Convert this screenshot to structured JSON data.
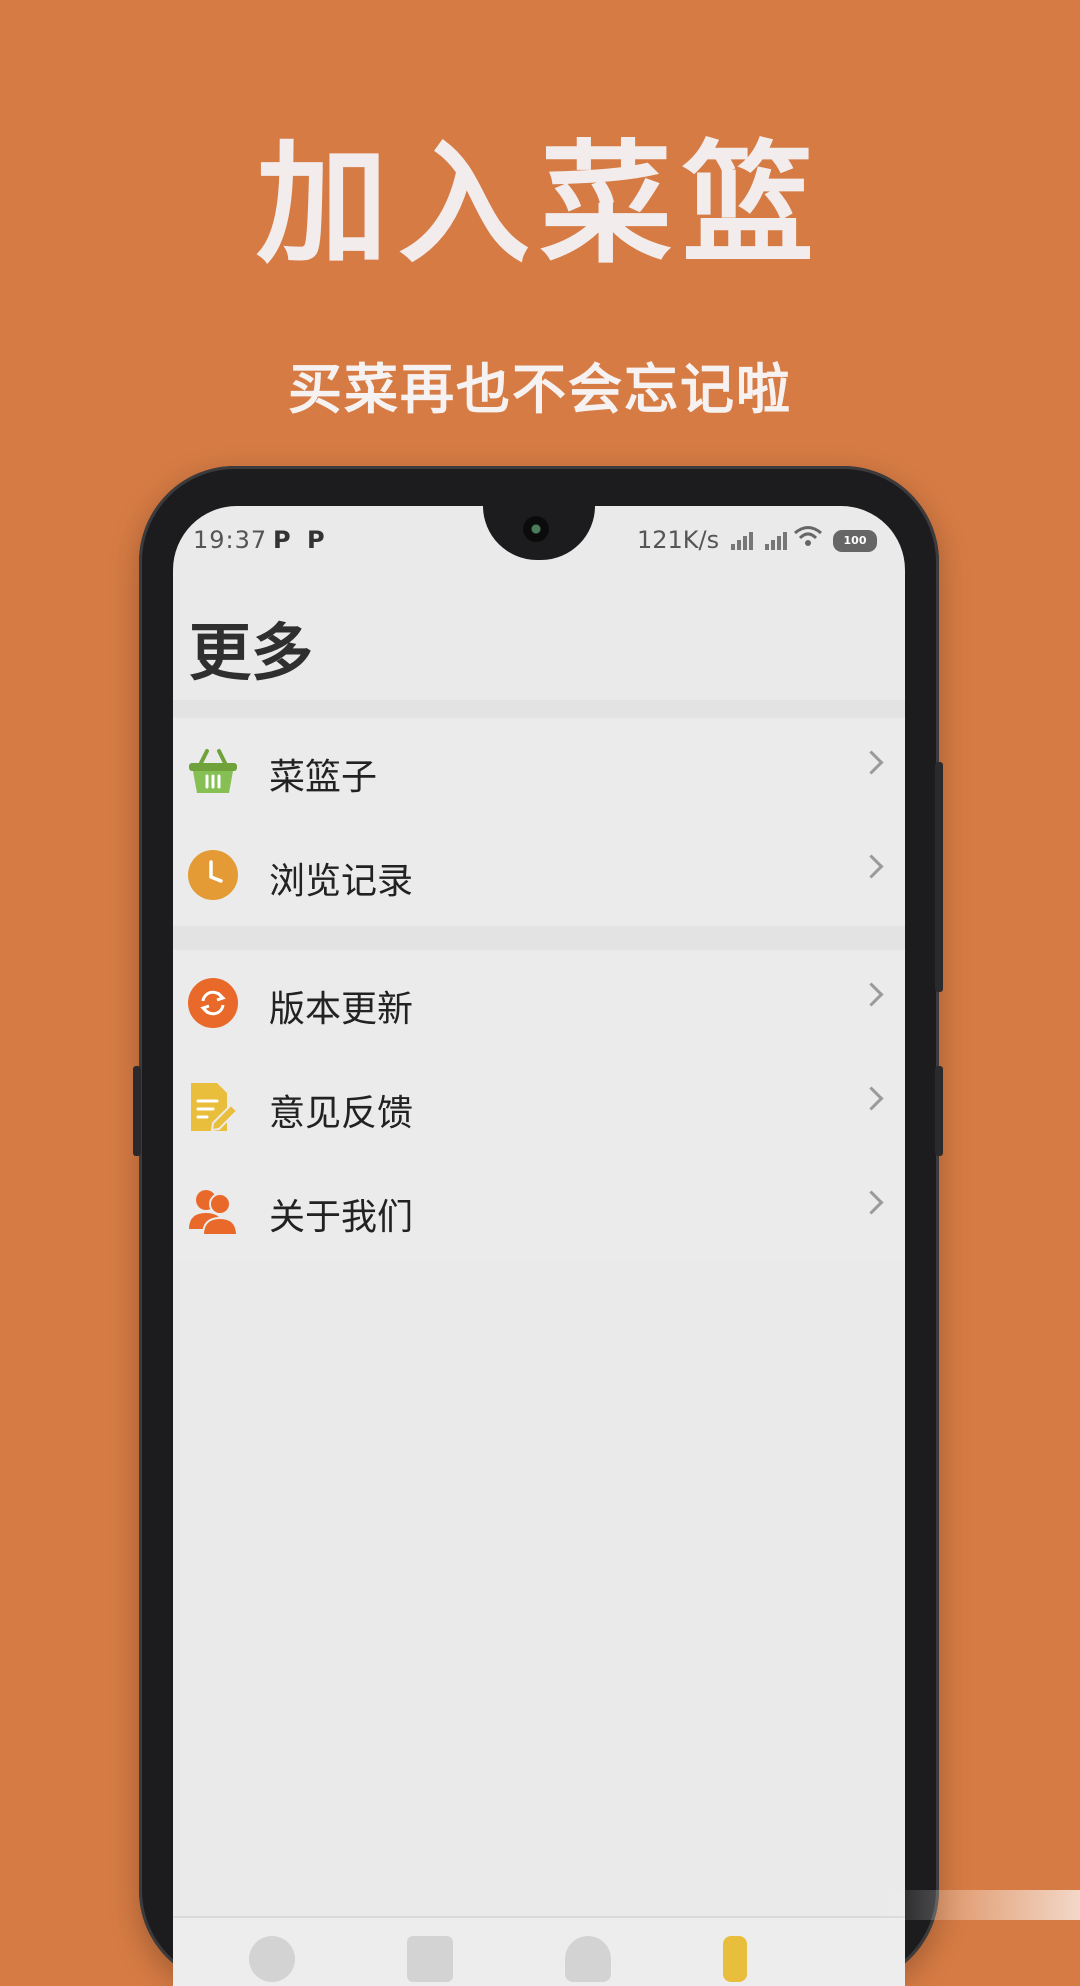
{
  "promo": {
    "headline": "加入菜篮",
    "subheadline": "买菜再也不会忘记啦"
  },
  "status_bar": {
    "time": "19:37",
    "indicator_1": "P",
    "indicator_2": "P",
    "network_speed": "121K/s",
    "battery": "100"
  },
  "page": {
    "title": "更多"
  },
  "menu": {
    "group1": [
      {
        "label": "菜篮子",
        "icon": "basket-icon",
        "color": "#7FB24B"
      },
      {
        "label": "浏览记录",
        "icon": "clock-icon",
        "color": "#E49B35"
      }
    ],
    "group2": [
      {
        "label": "版本更新",
        "icon": "refresh-icon",
        "color": "#E9692A"
      },
      {
        "label": "意见反馈",
        "icon": "feedback-icon",
        "color": "#E9BE3C"
      },
      {
        "label": "关于我们",
        "icon": "users-icon",
        "color": "#E9692A"
      }
    ]
  },
  "colors": {
    "background": "#D67B44",
    "screen": "#EAEAEA"
  }
}
